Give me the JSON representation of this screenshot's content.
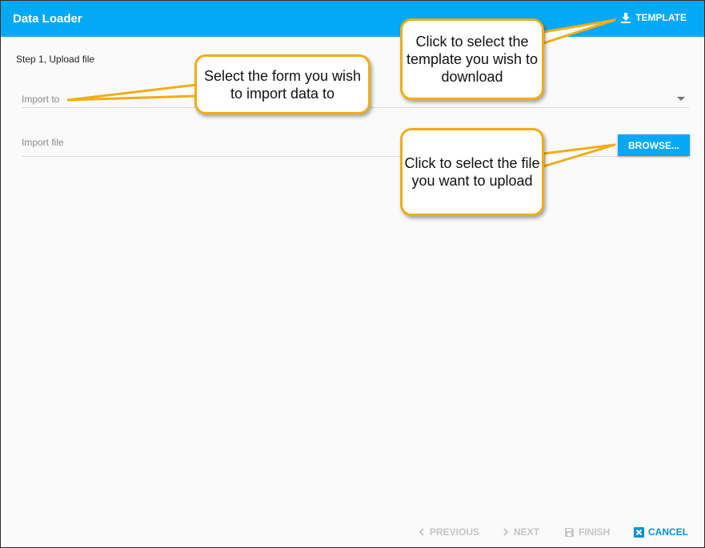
{
  "dialog": {
    "title": "Data Loader",
    "template_button": "TEMPLATE",
    "step_label": "Step 1, Upload file"
  },
  "form": {
    "import_to_label": "Import to",
    "import_file_label": "Import file",
    "browse_button": "BROWSE..."
  },
  "footer": {
    "previous": "PREVIOUS",
    "next": "NEXT",
    "finish": "FINISH",
    "cancel": "CANCEL"
  },
  "callouts": {
    "template": "Click to select the template you wish to download",
    "import_to": "Select the form you wish to import data to",
    "browse": "Click to select the file you want to upload"
  },
  "colors": {
    "header": "#03a9f4",
    "callout_border": "#f0ad18",
    "cancel": "#0a8fd7",
    "disabled": "#c5c5c5"
  },
  "icons": {
    "template": "download-icon",
    "previous": "chevron-left-icon",
    "next": "chevron-right-icon",
    "finish": "save-icon",
    "cancel": "close-box-icon",
    "import_to_dropdown": "caret-down-icon"
  }
}
